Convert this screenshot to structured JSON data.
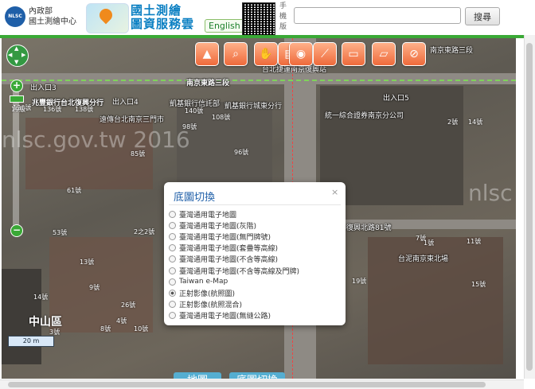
{
  "header": {
    "logo_text": "NLSC",
    "agency_line1": "內政部",
    "agency_line2": "國土測繪中心",
    "app_title_line1": "國土測繪",
    "app_title_line2": "圖資服務雲",
    "english_label": "English",
    "mobile_label": "手機版",
    "search_placeholder": "",
    "search_button": "搜尋"
  },
  "map": {
    "watermark": "nlsc.gov.tw 2016",
    "watermark_right": "nlsc",
    "district": "中山區",
    "zoom_level": "19級",
    "scale": "20 m",
    "labels": {
      "exit3": "出入口3",
      "exit4": "出入口4",
      "exit5": "出入口5",
      "bank1": "兆豐銀行台北復興分行",
      "bank2": "凱基銀行信託部",
      "bank3": "凱基銀行城東分行",
      "post": "遠傳台北南京三門市",
      "station": "台北捷運南京復興站",
      "road_top": "南京東路三段",
      "road_top_right": "南京東路三段",
      "road_left": "南京東路三段",
      "company": "統一綜合證券南京分公司",
      "road_mid": "復興北路81號",
      "north_office": "台泥南京東北場",
      "side_road": "南京東路三段"
    },
    "numbers": [
      "136號",
      "136號",
      "138號",
      "140號",
      "108號",
      "96號",
      "85號",
      "98號",
      "61號",
      "53號",
      "7號",
      "11號",
      "15號",
      "19號",
      "1號",
      "2號",
      "14號",
      "14號",
      "13號",
      "9號",
      "3號",
      "26號",
      "2之2號",
      "8號",
      "4號",
      "10號"
    ]
  },
  "toolbar": {
    "tools": [
      {
        "name": "taiwan-map-icon",
        "glyph": "▲"
      },
      {
        "name": "zoom-search-icon",
        "glyph": "⌕"
      },
      {
        "name": "pan-hand-icon",
        "glyph": "✋"
      },
      {
        "name": "layers-icon",
        "glyph": "▤"
      },
      {
        "name": "location-icon",
        "glyph": "◉"
      },
      {
        "name": "measure-icon",
        "glyph": "⟋"
      },
      {
        "name": "screen-icon",
        "glyph": "▭"
      },
      {
        "name": "eraser-icon",
        "glyph": "▱"
      },
      {
        "name": "clear-location-icon",
        "glyph": "⊘"
      }
    ]
  },
  "basemap_popup": {
    "title": "底圖切換",
    "close": "×",
    "options": [
      {
        "label": "臺灣通用電子地圖",
        "selected": false
      },
      {
        "label": "臺灣通用電子地圖(灰階)",
        "selected": false
      },
      {
        "label": "臺灣通用電子地圖(無門牌號)",
        "selected": false
      },
      {
        "label": "臺灣通用電子地圖(套疊等高線)",
        "selected": false
      },
      {
        "label": "臺灣通用電子地圖(不含等高線)",
        "selected": false
      },
      {
        "label": "臺灣通用電子地圖(不含等高線及門牌)",
        "selected": false
      },
      {
        "label": "Taiwan e-Map",
        "selected": false
      },
      {
        "label": "正射影像(航照圖)",
        "selected": true
      },
      {
        "label": "正射影像(航照混合)",
        "selected": false
      },
      {
        "label": "臺灣通用電子地圖(無縫公路)",
        "selected": false
      }
    ]
  },
  "tabs": {
    "map": "地圖",
    "basemap": "底圖切換"
  }
}
